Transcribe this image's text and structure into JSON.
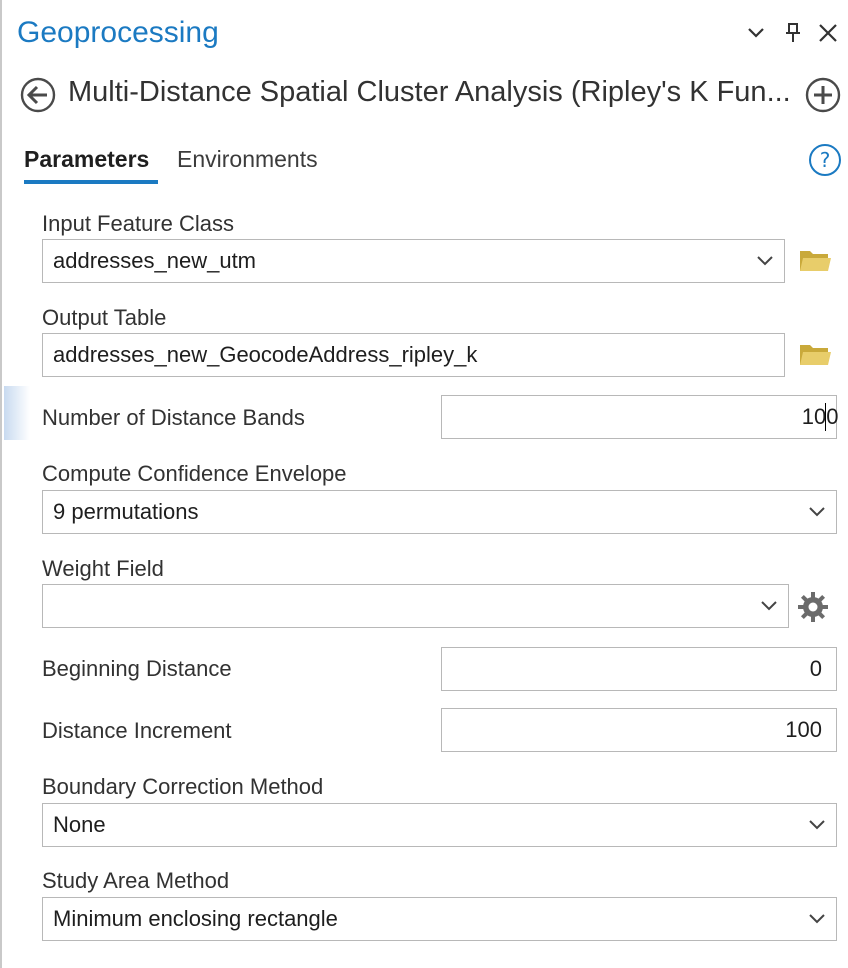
{
  "pane": {
    "title": "Geoprocessing",
    "tool_title": "Multi-Distance Spatial Cluster Analysis (Ripley's K Fun..."
  },
  "tabs": [
    {
      "label": "Parameters"
    },
    {
      "label": "Environments"
    }
  ],
  "params": {
    "input_feature_class": {
      "label": "Input Feature Class",
      "value": "addresses_new_utm"
    },
    "output_table": {
      "label": "Output Table",
      "value": "addresses_new_GeocodeAddress_ripley_k"
    },
    "number_of_distance_bands": {
      "label": "Number of Distance Bands",
      "value": "100"
    },
    "compute_confidence_envelope": {
      "label": "Compute Confidence Envelope",
      "value": "9 permutations"
    },
    "weight_field": {
      "label": "Weight Field",
      "value": ""
    },
    "beginning_distance": {
      "label": "Beginning Distance",
      "value": "0"
    },
    "distance_increment": {
      "label": "Distance Increment",
      "value": "100"
    },
    "boundary_correction_method": {
      "label": "Boundary Correction Method",
      "value": "None"
    },
    "study_area_method": {
      "label": "Study Area Method",
      "value": "Minimum enclosing rectangle"
    }
  },
  "icons": {
    "menu": "chevron-down-icon",
    "pin": "pin-icon",
    "close": "close-icon",
    "back": "back-arrow-icon",
    "add": "add-circle-icon",
    "help": "help-icon",
    "browse": "folder-icon",
    "settings": "gear-icon"
  },
  "colors": {
    "accent": "#1b7ac2",
    "folder": "#dcc25a"
  }
}
